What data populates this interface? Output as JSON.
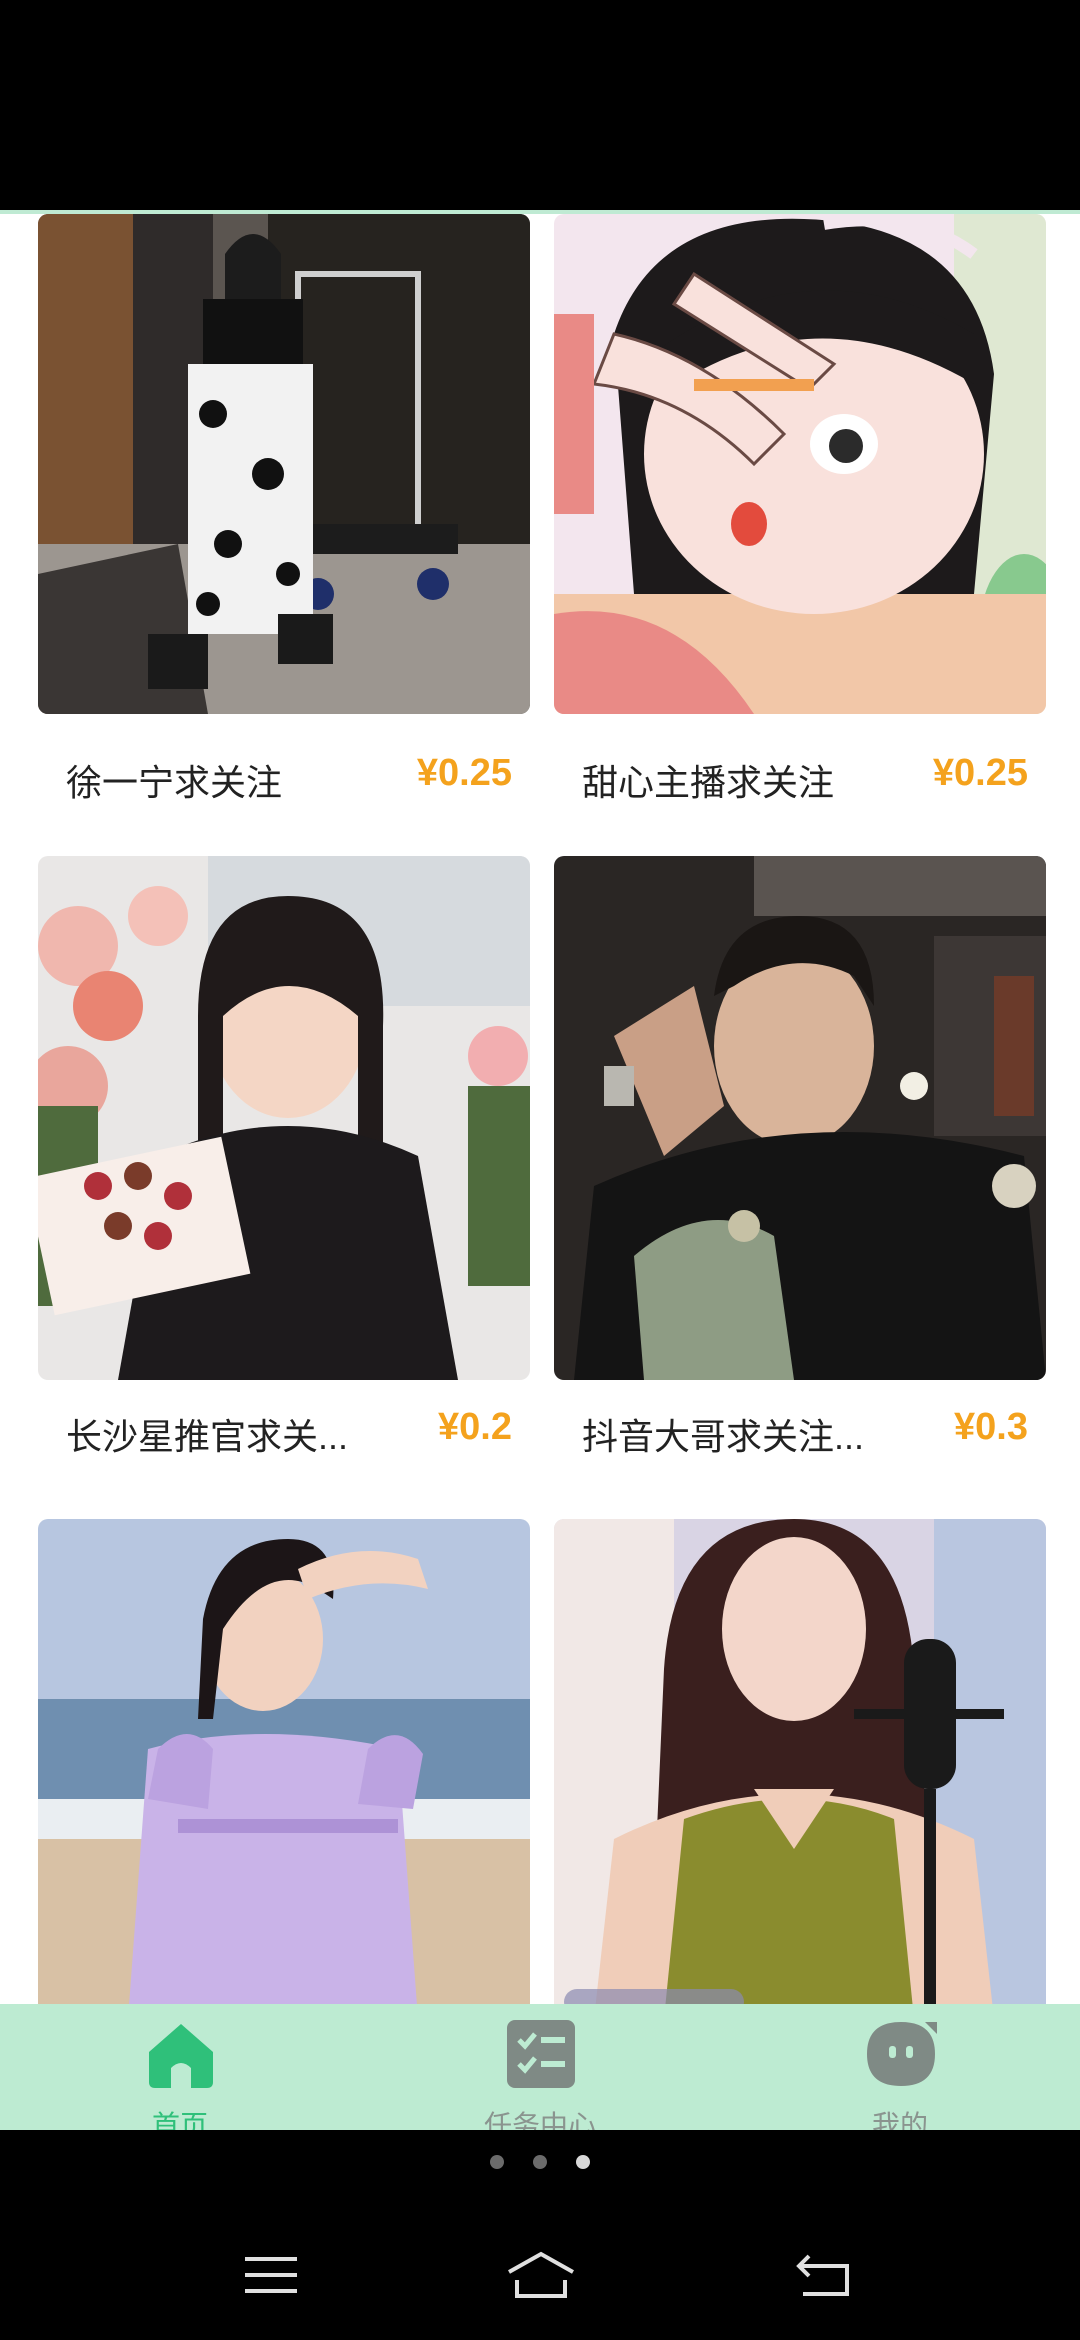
{
  "feed": {
    "cards": [
      {
        "title": "徐一宁求关注",
        "price": "¥0.25"
      },
      {
        "title": "甜心主播求关注",
        "price": "¥0.25"
      },
      {
        "title": "长沙星推官求关...",
        "price": "¥0.2"
      },
      {
        "title": "抖音大哥求关注...",
        "price": "¥0.3"
      }
    ]
  },
  "bottom_nav": {
    "items": [
      {
        "label": "首页",
        "active": true,
        "icon": "home-icon"
      },
      {
        "label": "任务中心",
        "active": false,
        "icon": "task-list-icon"
      },
      {
        "label": "我的",
        "active": false,
        "icon": "profile-face-icon"
      }
    ]
  },
  "pager": {
    "count": 3,
    "active_index": 2
  },
  "colors": {
    "accent": "#2fc07a",
    "price": "#f4a21d",
    "nav_bg": "#bdebd2"
  }
}
